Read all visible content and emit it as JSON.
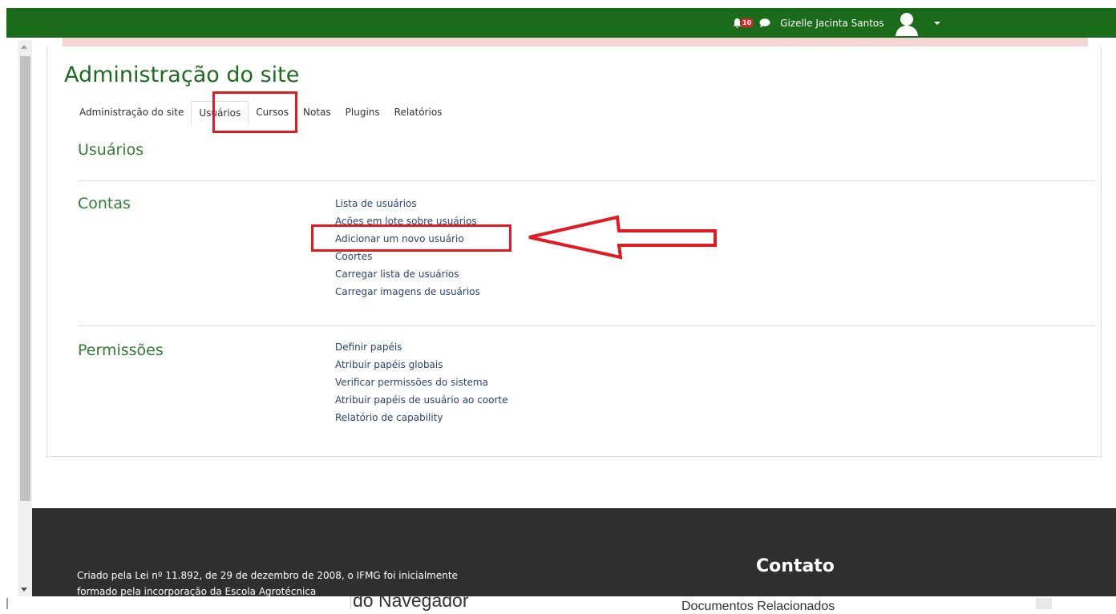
{
  "navbar": {
    "notification_count": "10",
    "username": "Gizelle Jacinta Santos",
    "bg_color": "#1a6b1a"
  },
  "page": {
    "title": "Administração do site"
  },
  "tabs": [
    {
      "label": "Administração do site"
    },
    {
      "label": "Usuários",
      "active": true
    },
    {
      "label": "Cursos"
    },
    {
      "label": "Notas"
    },
    {
      "label": "Plugins"
    },
    {
      "label": "Relatórios"
    }
  ],
  "current_section": "Usuários",
  "sections": {
    "contas": {
      "heading": "Contas",
      "links": [
        "Lista de usuários",
        "Ações em lote sobre usuários",
        "Adicionar um novo usuário",
        "Coortes",
        "Carregar lista de usuários",
        "Carregar imagens de usuários"
      ]
    },
    "permissoes": {
      "heading": "Permissões",
      "links": [
        "Definir papéis",
        "Atribuir papéis globais",
        "Verificar permissões do sistema",
        "Atribuir papéis de usuário ao coorte",
        "Relatório de capability"
      ]
    }
  },
  "footer": {
    "text": "Criado pela Lei nº 11.892, de 29 de dezembro de 2008, o IFMG foi inicialmente formado pela incorporação da Escola Agrotécnica",
    "contact_heading": "Contato"
  },
  "overlay_window": {
    "left_text": "do Navegador",
    "right_text": "Documentos Relacionados"
  },
  "colors": {
    "accent_green": "#1f6b1f",
    "annotation_red": "#e21b23",
    "link_blue": "#2a4470"
  }
}
